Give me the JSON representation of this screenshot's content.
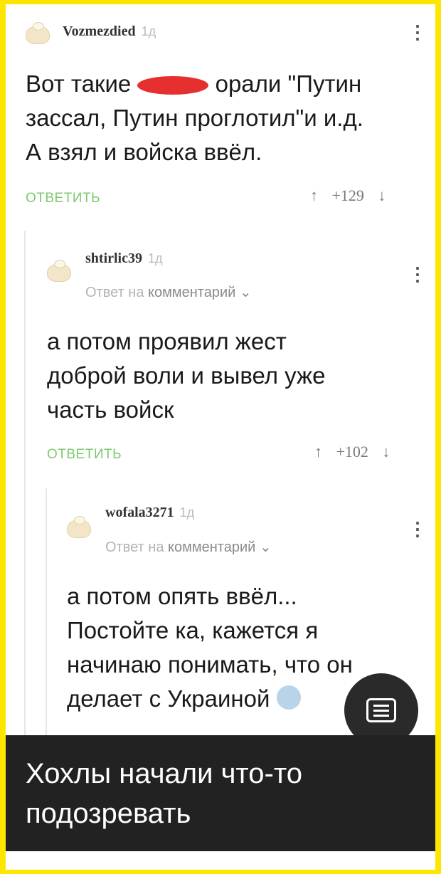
{
  "comments": [
    {
      "author": "Vozmezdied",
      "time": "1д",
      "lines": [
        "Вот такие ",
        " орали \"Путин",
        "зассал, Путин проглотил\"и и.д.",
        "А взял и войска ввёл."
      ],
      "reply_label": "ОТВЕТИТЬ",
      "rating": "+129"
    },
    {
      "author": "shtirlic39",
      "time": "1д",
      "reply_to_prefix": "Ответ на",
      "reply_to_target": "комментарий",
      "lines": [
        "а потом проявил жест",
        "доброй воли и вывел уже",
        "часть войск"
      ],
      "reply_label": "ОТВЕТИТЬ",
      "rating": "+102"
    },
    {
      "author": "wofala3271",
      "time": "1д",
      "reply_to_prefix": "Ответ на",
      "reply_to_target": "комментарий",
      "lines": [
        "а потом опять ввёл...",
        "Постойте ка, кажется я",
        "начинаю понимать, что он",
        "делает с Украиной"
      ]
    }
  ],
  "icons": {
    "up_arrow": "↑",
    "down_arrow": "↓",
    "more": "⋮",
    "chevron": "⌄"
  },
  "caption": "Хохлы начали что-то подозревать",
  "colors": {
    "frame": "#ffe600",
    "accent_green": "#7ec96d",
    "redaction": "#e63030",
    "caption_bg": "#222222"
  }
}
